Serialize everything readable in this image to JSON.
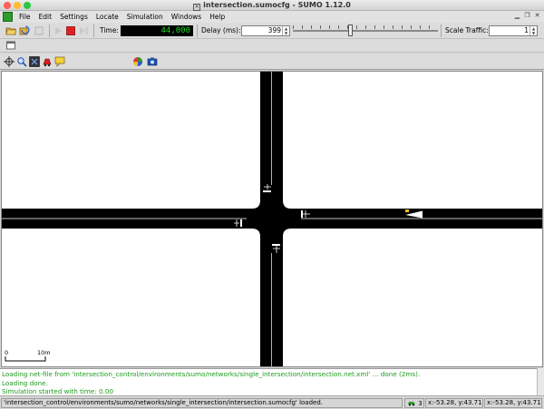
{
  "window": {
    "title": "intersection.sumocfg - SUMO 1.12.0"
  },
  "menu": {
    "items": [
      {
        "label": "File"
      },
      {
        "label": "Edit"
      },
      {
        "label": "Settings"
      },
      {
        "label": "Locate"
      },
      {
        "label": "Simulation"
      },
      {
        "label": "Windows"
      },
      {
        "label": "Help"
      }
    ]
  },
  "toolbar": {
    "time_label": "Time:",
    "time_value": "44,000",
    "delay_label": "Delay (ms):",
    "delay_value": "399",
    "scale_label": "Scale Traffic:",
    "scale_value": "1"
  },
  "view_toolbar": {
    "scheme_selected": "standard"
  },
  "view": {
    "scale_zero": "0",
    "scale_ten": "10m"
  },
  "log": {
    "lines": [
      "Loading net-file from 'intersection_control/environments/sumo/networks/single_intersection/intersection.net.xml' ... done (2ms).",
      "Loading done.",
      "Simulation started with time: 0.00"
    ]
  },
  "status": {
    "message": "'intersection_control/environments/sumo/networks/single_intersection/intersection.sumocfg' loaded.",
    "vehicle_count": "3",
    "coord1": "x:-53.28, y:43.71",
    "coord2": "x:-53.28, y:43.71"
  },
  "colors": {
    "road": "#000000",
    "time_text": "#1fd61f",
    "log_text": "#1c9a1c",
    "vehicle": "#f0c020"
  }
}
